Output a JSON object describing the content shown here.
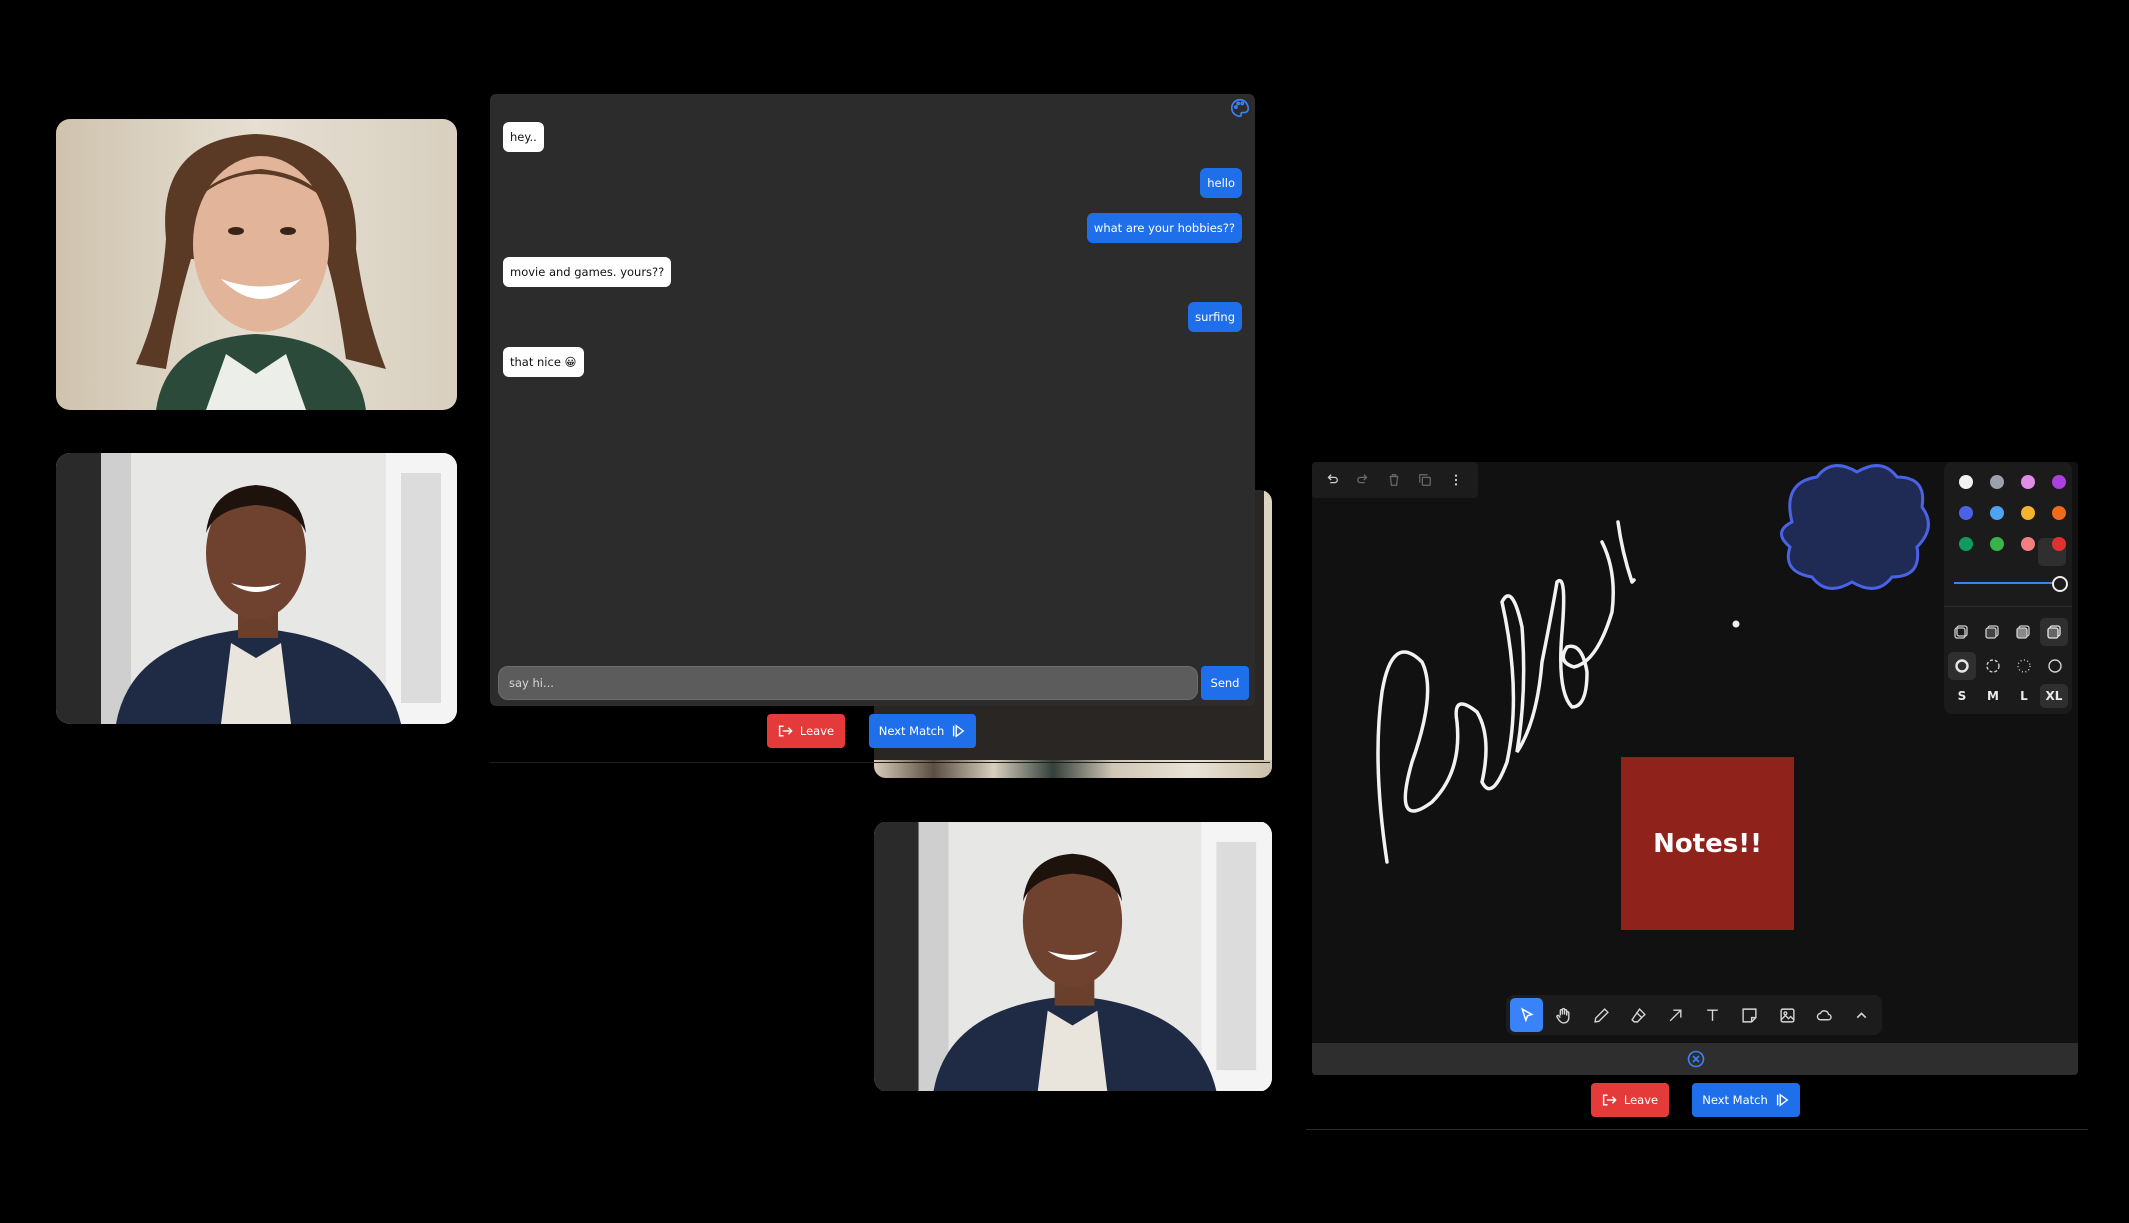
{
  "chat": {
    "messages": [
      {
        "side": "in",
        "text": "hey.."
      },
      {
        "side": "out",
        "text": "hello"
      },
      {
        "side": "out",
        "text": "what are your hobbies??"
      },
      {
        "side": "in",
        "text": "movie and games. yours??"
      },
      {
        "side": "out",
        "text": "surfing"
      },
      {
        "side": "in",
        "text": "that nice 😀"
      }
    ],
    "input_placeholder": "say hi...",
    "send_label": "Send"
  },
  "actions": {
    "leave_label": "Leave",
    "next_label": "Next Match"
  },
  "board": {
    "note_text": "Notes!!",
    "handwriting": "hello !",
    "colors": [
      "#f2f2f2",
      "#9aa0ad",
      "#e08be6",
      "#ad3ee0",
      "#4a63e6",
      "#4ea3f0",
      "#f3b32a",
      "#f06a1c",
      "#0e9b5f",
      "#3cb34a",
      "#f27f7f",
      "#e03131"
    ],
    "selected_color": "#e03131",
    "sizes": [
      "S",
      "M",
      "L",
      "XL"
    ],
    "selected_size": "XL",
    "cloud_color": "#4a63e6",
    "tools": [
      "select-icon",
      "hand-icon",
      "pencil-icon",
      "eraser-icon",
      "arrow-icon",
      "text-icon",
      "note-icon",
      "image-icon",
      "cloud-icon",
      "chevron-up-icon"
    ],
    "active_tool": "select-icon"
  }
}
